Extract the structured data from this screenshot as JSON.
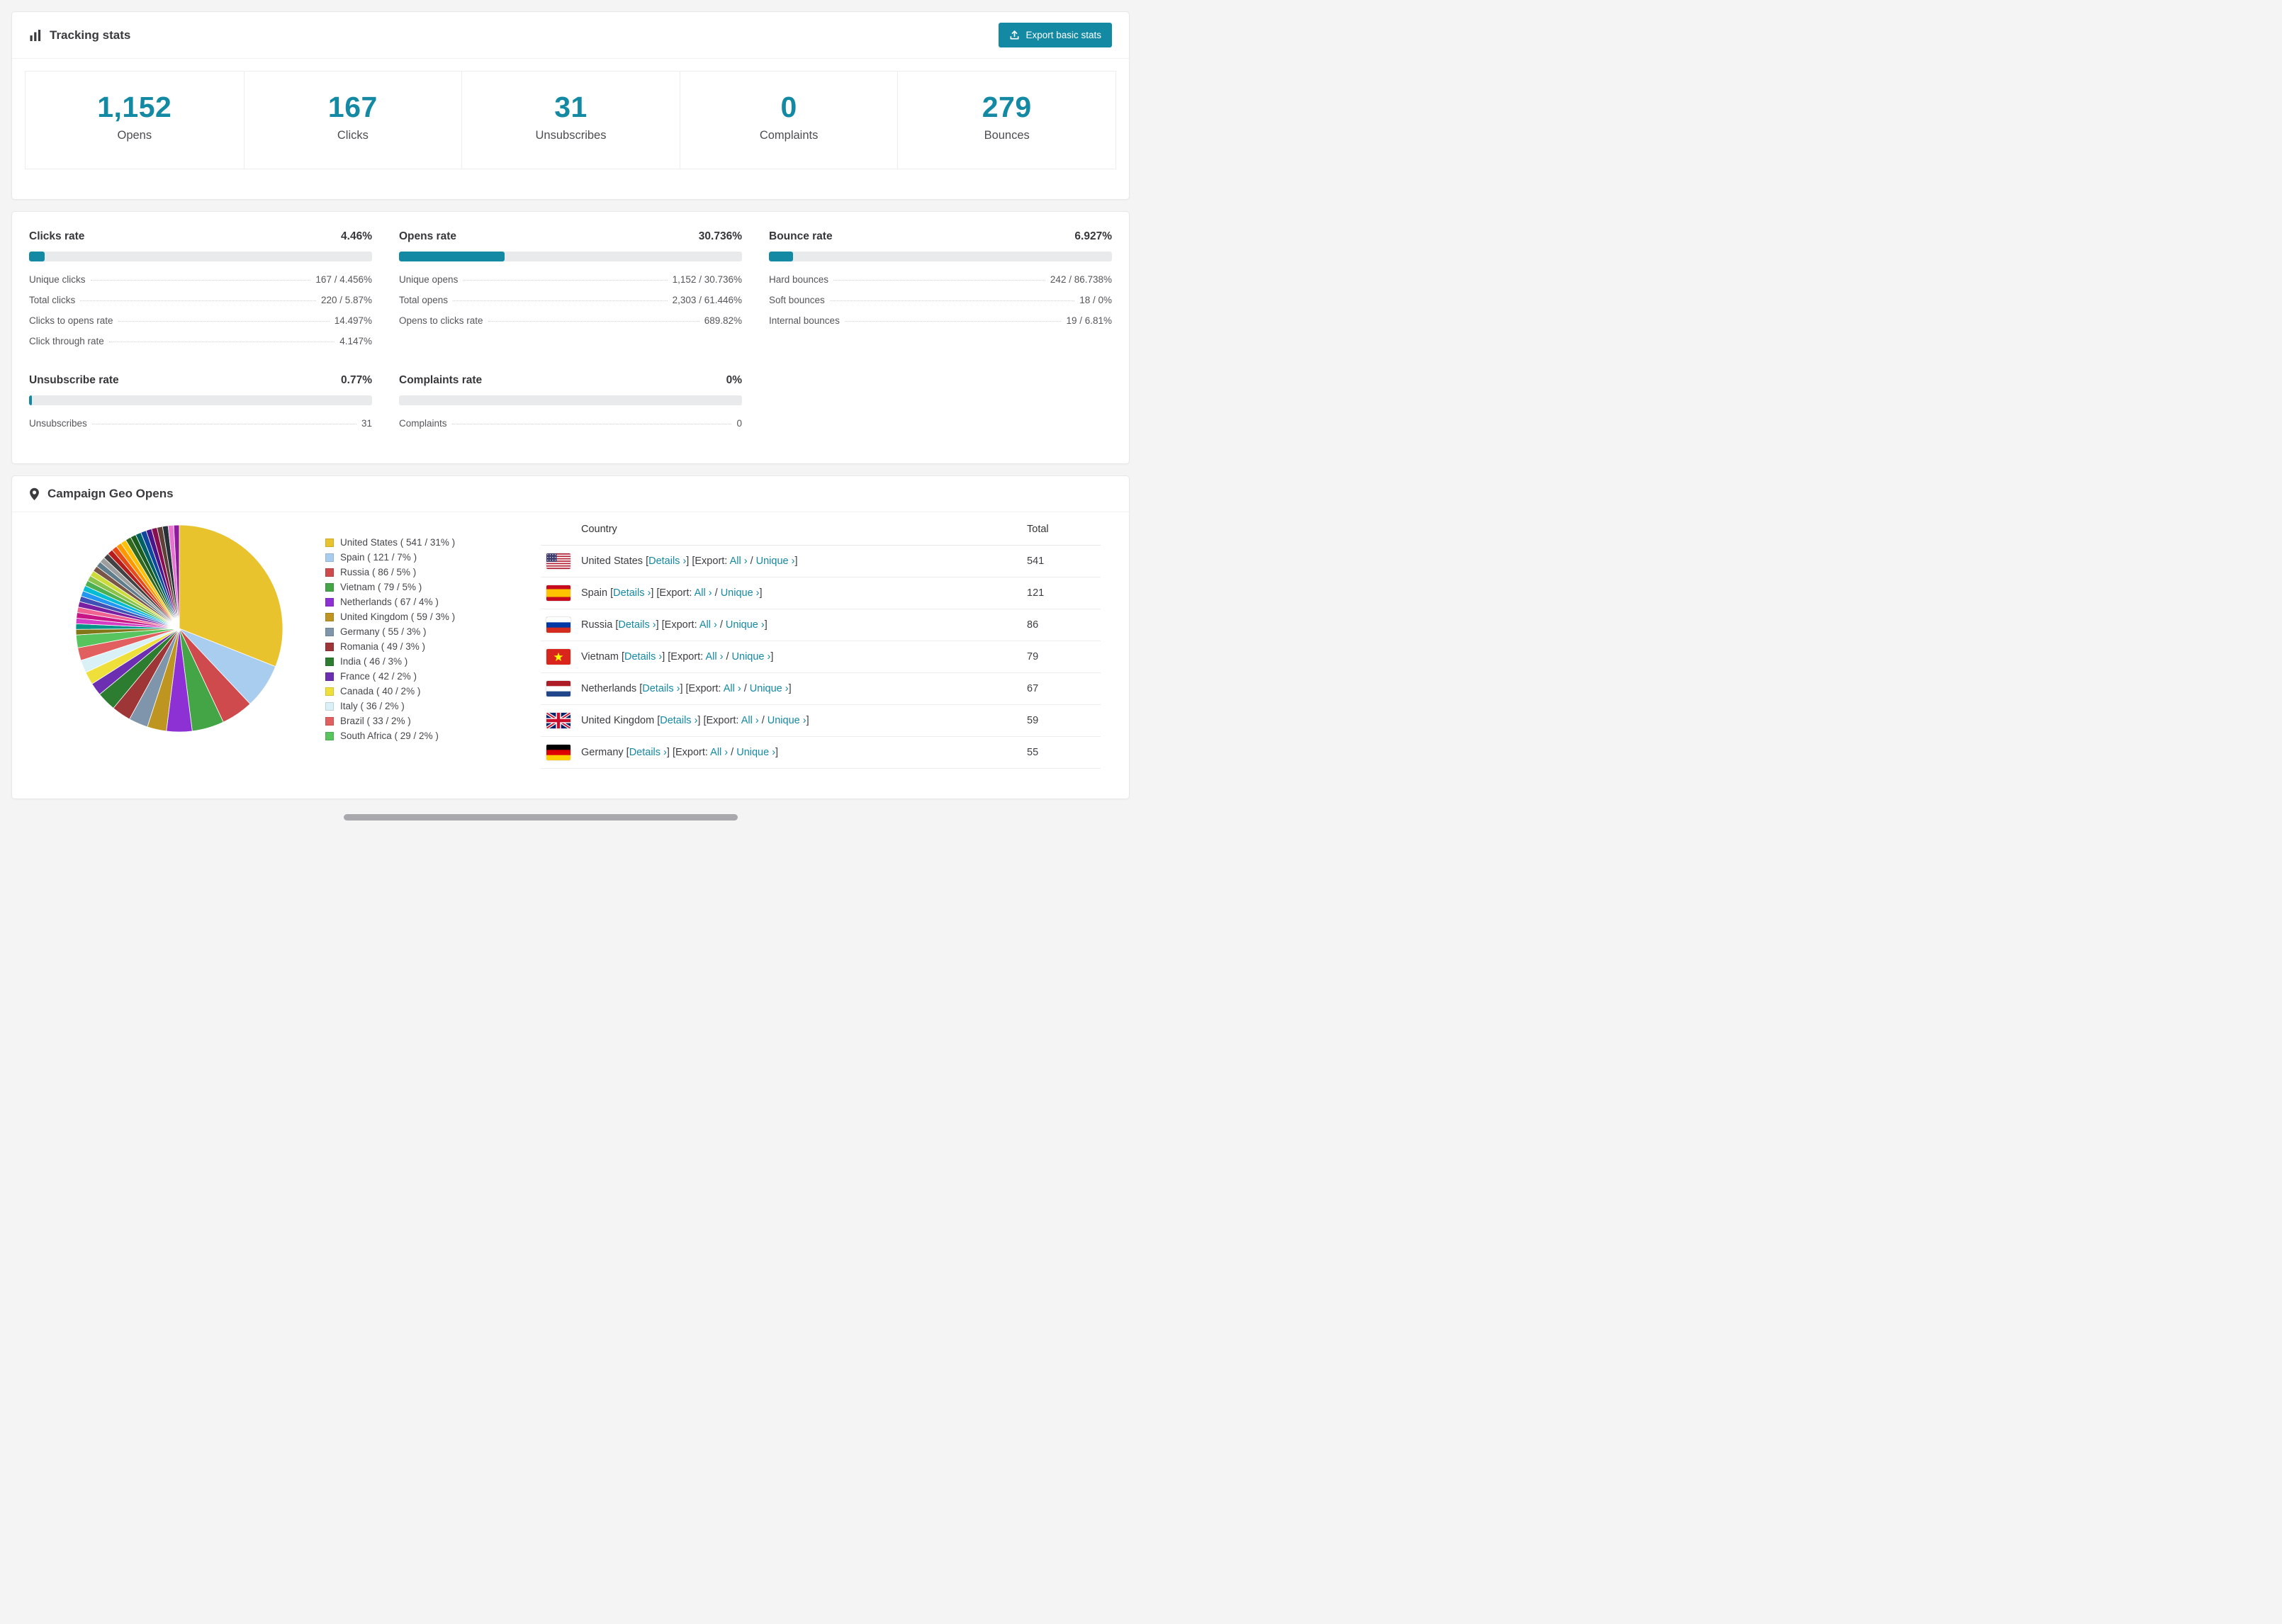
{
  "accent": "#1489a4",
  "tracking": {
    "title": "Tracking stats",
    "export_button": "Export basic stats",
    "stats": [
      {
        "value": "1,152",
        "label": "Opens"
      },
      {
        "value": "167",
        "label": "Clicks"
      },
      {
        "value": "31",
        "label": "Unsubscribes"
      },
      {
        "value": "0",
        "label": "Complaints"
      },
      {
        "value": "279",
        "label": "Bounces"
      }
    ]
  },
  "rates": [
    {
      "title": "Clicks rate",
      "value": "4.46%",
      "fill_pct": 4.46,
      "rows": [
        {
          "label": "Unique clicks",
          "value": "167 / 4.456%"
        },
        {
          "label": "Total clicks",
          "value": "220 / 5.87%"
        },
        {
          "label": "Clicks to opens rate",
          "value": "14.497%"
        },
        {
          "label": "Click through rate",
          "value": "4.147%"
        }
      ]
    },
    {
      "title": "Opens rate",
      "value": "30.736%",
      "fill_pct": 30.736,
      "rows": [
        {
          "label": "Unique opens",
          "value": "1,152 / 30.736%"
        },
        {
          "label": "Total opens",
          "value": "2,303 / 61.446%"
        },
        {
          "label": "Opens to clicks rate",
          "value": "689.82%"
        }
      ]
    },
    {
      "title": "Bounce rate",
      "value": "6.927%",
      "fill_pct": 6.927,
      "rows": [
        {
          "label": "Hard bounces",
          "value": "242 / 86.738%"
        },
        {
          "label": "Soft bounces",
          "value": "18 / 0%"
        },
        {
          "label": "Internal bounces",
          "value": "19 / 6.81%"
        }
      ]
    },
    {
      "title": "Unsubscribe rate",
      "value": "0.77%",
      "fill_pct": 0.77,
      "rows": [
        {
          "label": "Unsubscribes",
          "value": "31"
        }
      ]
    },
    {
      "title": "Complaints rate",
      "value": "0%",
      "fill_pct": 0,
      "rows": [
        {
          "label": "Complaints",
          "value": "0"
        }
      ]
    }
  ],
  "geo": {
    "title": "Campaign Geo Opens",
    "table": {
      "country_header": "Country",
      "total_header": "Total",
      "details_label": "Details ›",
      "export_label": "[Export:",
      "all_label": "All ›",
      "unique_label": "Unique ›",
      "rows": [
        {
          "country": "United States",
          "flag": "us",
          "total": "541"
        },
        {
          "country": "Spain",
          "flag": "es",
          "total": "121"
        },
        {
          "country": "Russia",
          "flag": "ru",
          "total": "86"
        },
        {
          "country": "Vietnam",
          "flag": "vn",
          "total": "79"
        },
        {
          "country": "Netherlands",
          "flag": "nl",
          "total": "67"
        },
        {
          "country": "United Kingdom",
          "flag": "gb",
          "total": "59"
        },
        {
          "country": "Germany",
          "flag": "de",
          "total": "55"
        }
      ]
    }
  },
  "chart_data": {
    "type": "pie",
    "title": "Campaign Geo Opens",
    "legend_position": "right",
    "start_angle": 0,
    "direction": "clockwise",
    "slices": [
      {
        "label": "United States",
        "count": 541,
        "pct": 31,
        "color": "#e8c32e"
      },
      {
        "label": "Spain",
        "count": 121,
        "pct": 7,
        "color": "#a9cdee"
      },
      {
        "label": "Russia",
        "count": 86,
        "pct": 5,
        "color": "#cf4a4c"
      },
      {
        "label": "Vietnam",
        "count": 79,
        "pct": 5,
        "color": "#43a546"
      },
      {
        "label": "Netherlands",
        "count": 67,
        "pct": 4,
        "color": "#8e31d4"
      },
      {
        "label": "United Kingdom",
        "count": 59,
        "pct": 3,
        "color": "#bd9520"
      },
      {
        "label": "Germany",
        "count": 55,
        "pct": 3,
        "color": "#7e95ab"
      },
      {
        "label": "Romania",
        "count": 49,
        "pct": 3,
        "color": "#9e3537"
      },
      {
        "label": "India",
        "count": 46,
        "pct": 3,
        "color": "#2c7d30"
      },
      {
        "label": "France",
        "count": 42,
        "pct": 2,
        "color": "#6d2fb2"
      },
      {
        "label": "Canada",
        "count": 40,
        "pct": 2,
        "color": "#efdf3a"
      },
      {
        "label": "Italy",
        "count": 36,
        "pct": 2,
        "color": "#d9f1f6"
      },
      {
        "label": "Brazil",
        "count": 33,
        "pct": 2,
        "color": "#e25f60"
      },
      {
        "label": "South Africa",
        "count": 29,
        "pct": 2,
        "color": "#57c45d"
      }
    ],
    "other_slices_total_pct": 26,
    "other_slice_colors": [
      "#827717",
      "#009688",
      "#d33cc4",
      "#c71585",
      "#f06292",
      "#7b1fa2",
      "#3f51b5",
      "#2196f3",
      "#00bcd4",
      "#4caf50",
      "#8bc34a",
      "#cddc39",
      "#795548",
      "#607d8b",
      "#9e9e9e",
      "#424242",
      "#b71c1c",
      "#e64a19",
      "#ff9800",
      "#ffc107",
      "#33691e",
      "#1b5e20",
      "#006064",
      "#0d47a1",
      "#4a148c",
      "#880e4f",
      "#5d4037",
      "#263238",
      "#e874d2",
      "#8f1a9e"
    ]
  }
}
